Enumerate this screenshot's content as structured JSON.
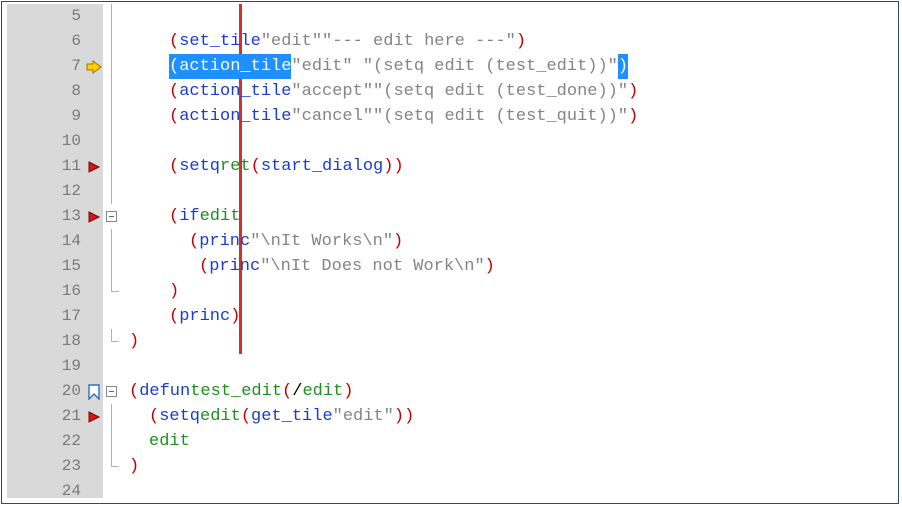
{
  "gutter": {
    "start": 5,
    "end": 24
  },
  "markers": {
    "current_line": 7,
    "breakpoints": [
      11,
      13,
      21
    ],
    "bookmark": 20
  },
  "fold": {
    "collapsible_at": [
      13,
      20
    ],
    "vline_segments": [
      {
        "from": 5,
        "to": 12
      },
      {
        "from": 14,
        "to": 15
      },
      {
        "from": 21,
        "to": 22
      }
    ],
    "elbow_at": [
      16,
      18,
      23
    ]
  },
  "change_bar": {
    "from": 5,
    "to": 18
  },
  "code": {
    "5": {
      "indent": 0,
      "tokens": []
    },
    "6": {
      "indent": 4,
      "tokens": [
        [
          "p",
          "("
        ],
        [
          "kw",
          "set_tile"
        ],
        [
          "",
          " "
        ],
        [
          "str",
          "\"edit\""
        ],
        [
          "",
          " "
        ],
        [
          "str",
          "\"--- edit here ---\""
        ],
        [
          "p",
          ")"
        ]
      ]
    },
    "7": {
      "indent": 4,
      "selected": true,
      "tokens": [
        [
          "p",
          "("
        ],
        [
          "kw",
          "action_tile"
        ],
        [
          "",
          " "
        ],
        [
          "str",
          "\"edit\""
        ],
        [
          "",
          "   "
        ],
        [
          "str",
          "\"(setq edit (test_edit))\""
        ],
        [
          "p",
          ")"
        ]
      ]
    },
    "8": {
      "indent": 4,
      "tokens": [
        [
          "p",
          "("
        ],
        [
          "kw",
          "action_tile"
        ],
        [
          "",
          " "
        ],
        [
          "str",
          "\"accept\""
        ],
        [
          "",
          " "
        ],
        [
          "str",
          "\"(setq edit (test_done))\""
        ],
        [
          "p",
          ")"
        ]
      ]
    },
    "9": {
      "indent": 4,
      "tokens": [
        [
          "p",
          "("
        ],
        [
          "kw",
          "action_tile"
        ],
        [
          "",
          " "
        ],
        [
          "str",
          "\"cancel\""
        ],
        [
          "",
          " "
        ],
        [
          "str",
          "\"(setq edit (test_quit))\""
        ],
        [
          "p",
          ")"
        ]
      ]
    },
    "10": {
      "indent": 0,
      "tokens": []
    },
    "11": {
      "indent": 4,
      "tokens": [
        [
          "p",
          "("
        ],
        [
          "kw",
          "setq"
        ],
        [
          "",
          " "
        ],
        [
          "id",
          "ret"
        ],
        [
          "",
          " "
        ],
        [
          "p",
          "("
        ],
        [
          "kw",
          "start_dialog"
        ],
        [
          "p",
          "))"
        ]
      ]
    },
    "12": {
      "indent": 0,
      "tokens": []
    },
    "13": {
      "indent": 4,
      "tokens": [
        [
          "p",
          "("
        ],
        [
          "kw",
          "if"
        ],
        [
          "",
          " "
        ],
        [
          "id",
          "edit"
        ]
      ]
    },
    "14": {
      "indent": 6,
      "tokens": [
        [
          "p",
          "("
        ],
        [
          "kw",
          "princ"
        ],
        [
          "",
          " "
        ],
        [
          "str",
          "\"\\nIt Works\\n\""
        ],
        [
          "p",
          ")"
        ]
      ]
    },
    "15": {
      "indent": 7,
      "tokens": [
        [
          "p",
          "("
        ],
        [
          "kw",
          "princ"
        ],
        [
          "",
          " "
        ],
        [
          "str",
          "\"\\nIt Does not Work\\n\""
        ],
        [
          "p",
          ")"
        ]
      ]
    },
    "16": {
      "indent": 4,
      "tokens": [
        [
          "p",
          ")"
        ]
      ]
    },
    "17": {
      "indent": 4,
      "tokens": [
        [
          "p",
          "("
        ],
        [
          "kw",
          "princ"
        ],
        [
          "p",
          ")"
        ]
      ]
    },
    "18": {
      "indent": 0,
      "tokens": [
        [
          "p",
          ")"
        ]
      ]
    },
    "19": {
      "indent": 0,
      "tokens": []
    },
    "20": {
      "indent": 0,
      "tokens": [
        [
          "p",
          "("
        ],
        [
          "kw",
          "defun"
        ],
        [
          "",
          " "
        ],
        [
          "id",
          "test_edit"
        ],
        [
          "",
          " "
        ],
        [
          "p",
          "("
        ],
        [
          "",
          " / "
        ],
        [
          "id",
          "edit"
        ],
        [
          "",
          " "
        ],
        [
          "p",
          ")"
        ]
      ]
    },
    "21": {
      "indent": 2,
      "tokens": [
        [
          "p",
          "("
        ],
        [
          "kw",
          "setq"
        ],
        [
          "",
          " "
        ],
        [
          "id",
          "edit"
        ],
        [
          "",
          " "
        ],
        [
          "p",
          "("
        ],
        [
          "kw",
          "get_tile"
        ],
        [
          "",
          " "
        ],
        [
          "str",
          "\"edit\""
        ],
        [
          "p",
          "))"
        ]
      ]
    },
    "22": {
      "indent": 2,
      "tokens": [
        [
          "id",
          "edit"
        ]
      ]
    },
    "23": {
      "indent": 0,
      "tokens": [
        [
          "p",
          ")"
        ]
      ]
    },
    "24": {
      "indent": 0,
      "tokens": []
    }
  }
}
